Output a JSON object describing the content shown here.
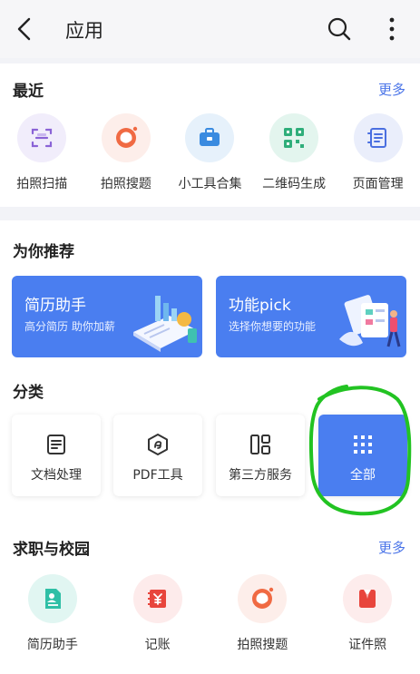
{
  "header": {
    "title": "应用"
  },
  "recent": {
    "title": "最近",
    "more": "更多",
    "items": [
      {
        "label": "拍照扫描",
        "icon": "scan-icon"
      },
      {
        "label": "拍照搜题",
        "icon": "photo-search-icon"
      },
      {
        "label": "小工具合集",
        "icon": "toolbox-icon"
      },
      {
        "label": "二维码生成",
        "icon": "qrcode-icon"
      },
      {
        "label": "页面管理",
        "icon": "page-manage-icon"
      }
    ]
  },
  "recommend": {
    "title": "为你推荐",
    "banners": [
      {
        "title": "简历助手",
        "subtitle": "高分简历 助你加薪"
      },
      {
        "title": "功能pick",
        "subtitle": "选择你想要的功能"
      }
    ]
  },
  "category": {
    "title": "分类",
    "items": [
      {
        "label": "文档处理",
        "icon": "document-icon"
      },
      {
        "label": "PDF工具",
        "icon": "pdf-icon"
      },
      {
        "label": "第三方服务",
        "icon": "third-party-icon"
      },
      {
        "label": "全部",
        "icon": "grid-icon"
      }
    ]
  },
  "jobs": {
    "title": "求职与校园",
    "more": "更多",
    "items": [
      {
        "label": "简历助手",
        "icon": "resume-icon"
      },
      {
        "label": "记账",
        "icon": "bookkeeping-icon"
      },
      {
        "label": "拍照搜题",
        "icon": "photo-search-icon"
      },
      {
        "label": "证件照",
        "icon": "id-photo-icon"
      }
    ]
  },
  "colors": {
    "accent": "#4a7ef0",
    "link": "#4a74e8",
    "annotation": "#22c322"
  }
}
